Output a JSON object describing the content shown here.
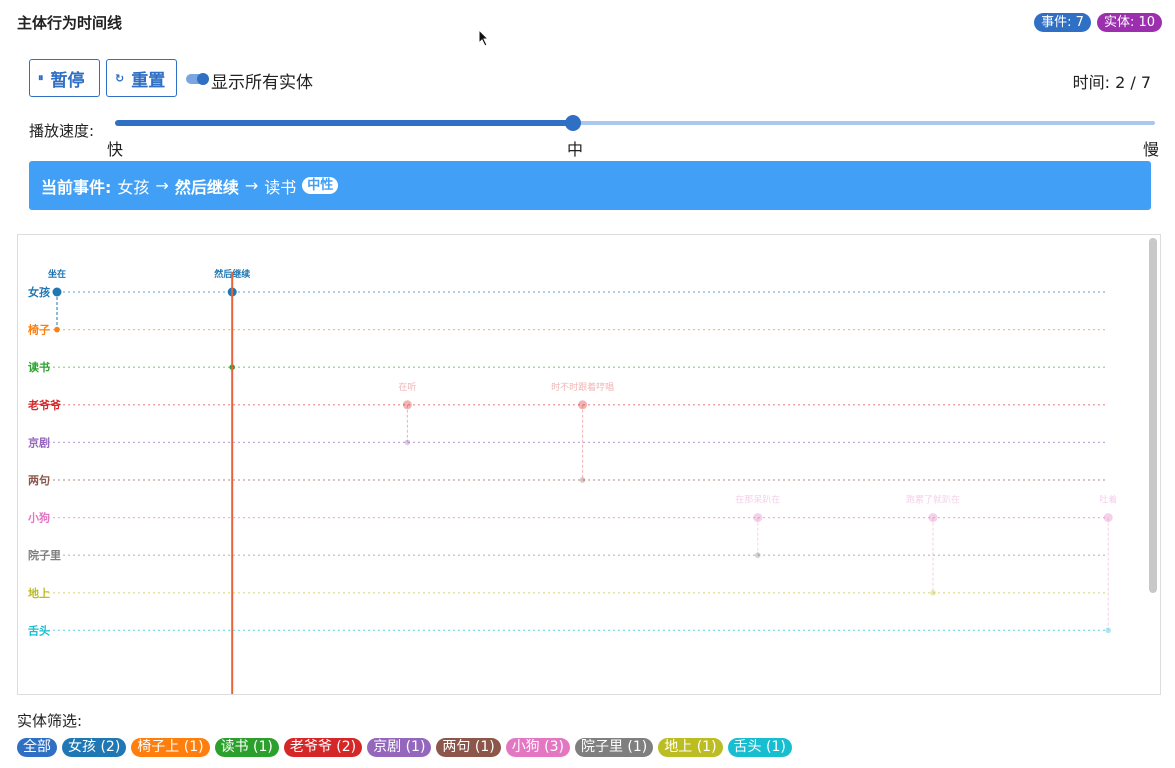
{
  "header": {
    "title": "主体行为时间线",
    "badge_events": "事件: 7",
    "badge_entities": "实体: 10"
  },
  "controls": {
    "pause_icon": "⏸",
    "pause_label": "暂停",
    "reset_icon": "↻",
    "reset_label": "重置",
    "toggle_label": "显示所有实体",
    "time_text": "时间: 2 / 7",
    "toggle_on": true
  },
  "speed": {
    "label": "播放速度:",
    "fast": "快",
    "mid": "中",
    "slow": "慢",
    "value": 0.44
  },
  "event": {
    "prefix": "当前事件:",
    "subject": "女孩",
    "arrow": "→",
    "action": "然后继续",
    "object": "读书",
    "sentiment": "中性"
  },
  "timeline": {
    "entities": [
      {
        "name": "女孩",
        "color": "#1f77b4"
      },
      {
        "name": "椅子",
        "color": "#ff7f0e"
      },
      {
        "name": "读书",
        "color": "#2ca02c"
      },
      {
        "name": "老爷爷",
        "color": "#d62728"
      },
      {
        "name": "京剧",
        "color": "#9467bd"
      },
      {
        "name": "两句",
        "color": "#8c564b"
      },
      {
        "name": "小狗",
        "color": "#e377c2"
      },
      {
        "name": "院子里",
        "color": "#7f7f7f"
      },
      {
        "name": "地上",
        "color": "#bcbd22"
      },
      {
        "name": "舌头",
        "color": "#17becf"
      }
    ],
    "events": [
      {
        "label": "坐在",
        "subject": 0,
        "object": 1,
        "step": 1,
        "active": true
      },
      {
        "label": "然后继续",
        "subject": 0,
        "object": 2,
        "step": 2,
        "active": true
      },
      {
        "label": "在听",
        "subject": 3,
        "object": 4,
        "step": 3,
        "active": false
      },
      {
        "label": "时不时跟着哼唱",
        "subject": 3,
        "object": 5,
        "step": 4,
        "active": false
      },
      {
        "label": "在那呆趴在",
        "subject": 6,
        "object": 7,
        "step": 5,
        "active": false
      },
      {
        "label": "跑累了就趴在",
        "subject": 6,
        "object": 8,
        "step": 6,
        "active": false
      },
      {
        "label": "吐着",
        "subject": 6,
        "object": 9,
        "step": 7,
        "active": false
      }
    ],
    "current_step": 2
  },
  "filter": {
    "label": "实体筛选:",
    "chips": [
      {
        "label": "全部",
        "color": "#2f6fc4"
      },
      {
        "label": "女孩 (2)",
        "color": "#1f77b4"
      },
      {
        "label": "椅子上 (1)",
        "color": "#ff7f0e"
      },
      {
        "label": "读书 (1)",
        "color": "#2ca02c"
      },
      {
        "label": "老爷爷 (2)",
        "color": "#d62728"
      },
      {
        "label": "京剧 (1)",
        "color": "#9467bd"
      },
      {
        "label": "两句 (1)",
        "color": "#8c564b"
      },
      {
        "label": "小狗 (3)",
        "color": "#e377c2"
      },
      {
        "label": "院子里 (1)",
        "color": "#7f7f7f"
      },
      {
        "label": "地上 (1)",
        "color": "#bcbd22"
      },
      {
        "label": "舌头 (1)",
        "color": "#17becf"
      }
    ]
  },
  "colors": {
    "accent": "#2f6fc4",
    "event_bar": "#41a0f5",
    "badge_events": "#2f6fc4",
    "badge_entities": "#9b2fae",
    "playhead": "#e8633a"
  }
}
